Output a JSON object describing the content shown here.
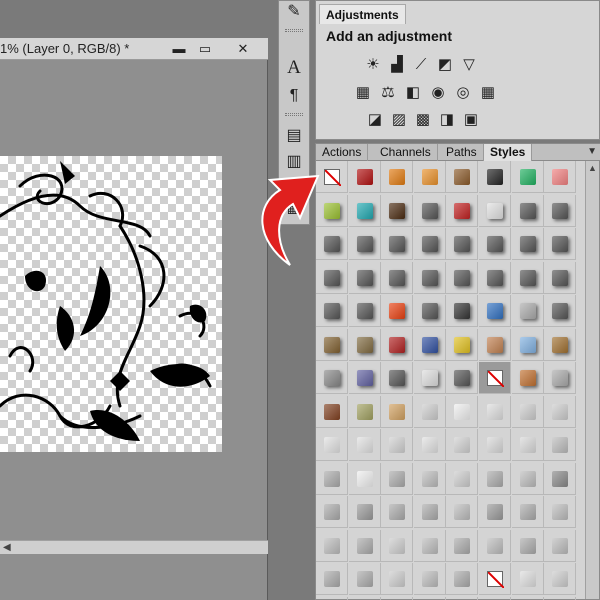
{
  "document": {
    "title": "1% (Layer 0, RGB/8) *",
    "minimize": "▬",
    "maximize": "▭",
    "close": "✕",
    "scroll_arrow": "◀"
  },
  "tools": [
    {
      "name": "brush-tool-icon",
      "glyph": "✎"
    },
    {
      "name": "character-panel-icon",
      "glyph": "A"
    },
    {
      "name": "paragraph-panel-icon",
      "glyph": "¶"
    },
    {
      "name": "info-panel-icon",
      "glyph": "▤"
    },
    {
      "name": "navigator-panel-icon",
      "glyph": "▥"
    },
    {
      "name": "layer-comps-icon",
      "glyph": "▦"
    }
  ],
  "adjustments": {
    "tab_label": "Adjustments",
    "heading": "Add an adjustment",
    "row1": [
      {
        "name": "brightness-contrast-icon",
        "glyph": "☀"
      },
      {
        "name": "levels-icon",
        "glyph": "▟"
      },
      {
        "name": "curves-icon",
        "glyph": "⟋"
      },
      {
        "name": "exposure-icon",
        "glyph": "◩"
      },
      {
        "name": "gradient-triangle-icon",
        "glyph": "▽"
      }
    ],
    "row2": [
      {
        "name": "hue-saturation-icon",
        "glyph": "▦"
      },
      {
        "name": "color-balance-icon",
        "glyph": "⚖"
      },
      {
        "name": "black-white-icon",
        "glyph": "◧"
      },
      {
        "name": "photo-filter-icon",
        "glyph": "◉"
      },
      {
        "name": "channel-mixer-icon",
        "glyph": "◎"
      },
      {
        "name": "color-lookup-icon",
        "glyph": "▦"
      }
    ],
    "row3": [
      {
        "name": "invert-icon",
        "glyph": "◪"
      },
      {
        "name": "posterize-icon",
        "glyph": "▨"
      },
      {
        "name": "threshold-icon",
        "glyph": "▩"
      },
      {
        "name": "gradient-map-icon",
        "glyph": "◨"
      },
      {
        "name": "selective-color-icon",
        "glyph": "▣"
      }
    ]
  },
  "styles_panel": {
    "tabs": [
      "Actions",
      "Channels",
      "Paths",
      "Styles"
    ],
    "active_tab": "Styles",
    "menu_glyph": "▼",
    "scroll_glyph": "▲",
    "styles": [
      "none",
      "#b01010",
      "#e07a10",
      "#e8902a",
      "#8a5a2a",
      "#222222",
      "#20b060",
      "#f08080",
      "#9ac030",
      "#20a8b0",
      "#4a2a10",
      "#555555",
      "#c02020",
      "#e0e0e0",
      "#555555",
      "#555555",
      "#555555",
      "#555555",
      "#555555",
      "#555555",
      "#555555",
      "#555555",
      "#555555",
      "#555555",
      "#555555",
      "#555555",
      "#555555",
      "#555555",
      "#555555",
      "#555555",
      "#555555",
      "#555555",
      "#555555",
      "#555555",
      "#e84010",
      "#555555",
      "#333333",
      "#3070c0",
      "#aaaaaa",
      "#555555",
      "#806030",
      "#806a40",
      "#b02020",
      "#3050a0",
      "#e0c020",
      "#c08050",
      "#80b0e0",
      "#a07030",
      "#888888",
      "#6060a0",
      "#555555",
      "#dddddd",
      "#555555",
      "none",
      "#c07030",
      "#aaaaaa",
      "#804020",
      "#a0a060",
      "#d0a060",
      "#cccccc",
      "#eeeeee",
      "#dddddd",
      "#cccccc",
      "#cccccc",
      "#e0e0e0",
      "#e0e0e0",
      "#d0d0d0",
      "#e0e0e0",
      "#d0d0d0",
      "#d8d8d8",
      "#d8d8d8",
      "#bbbbbb",
      "#aaaaaa",
      "#eeeeee",
      "#aaaaaa",
      "#bbbbbb",
      "#cccccc",
      "#aaaaaa",
      "#bbbbbb",
      "#888888",
      "#aaaaaa",
      "#999999",
      "#aaaaaa",
      "#aaaaaa",
      "#bbbbbb",
      "#999999",
      "#aaaaaa",
      "#bbbbbb",
      "#bbbbbb",
      "#aaaaaa",
      "#cccccc",
      "#bbbbbb",
      "#aaaaaa",
      "#bbbbbb",
      "#aaaaaa",
      "#bbbbbb",
      "#aaaaaa",
      "#aaaaaa",
      "#cccccc",
      "#bbbbbb",
      "#aaaaaa",
      "none",
      "#dddddd",
      "#cccccc",
      "#cccccc",
      "#dddddd",
      "#cccccc",
      "#dddddd",
      "#dddddd",
      "#cccccc",
      "#dddddd",
      "#cccccc"
    ],
    "selected_index": 53
  },
  "colors": {
    "annotation_arrow": "#e0201e"
  }
}
